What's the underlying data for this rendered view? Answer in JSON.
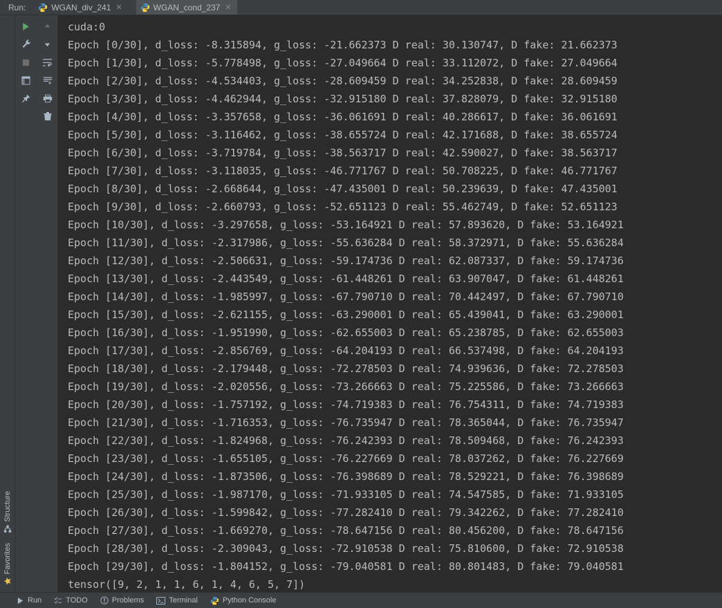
{
  "topbar": {
    "label": "Run:",
    "tabs": [
      {
        "name": "WGAN_div_241",
        "active": false
      },
      {
        "name": "WGAN_cond_237",
        "active": true
      }
    ]
  },
  "tool_buttons": [
    "run",
    "up-arrow",
    "wrench",
    "down-arrow",
    "stop",
    "soft-wrap",
    "layout",
    "scroll-to-end",
    "pin",
    "print",
    "",
    "trash"
  ],
  "left_rail": [
    {
      "label": "Structure",
      "icon": "structure-icon"
    },
    {
      "label": "Favorites",
      "icon": "star-icon"
    }
  ],
  "console": {
    "header": "cuda:0",
    "total_epochs": 30,
    "epochs": [
      {
        "i": 0,
        "d_loss": "-8.315894",
        "g_loss": "-21.662373",
        "d_real": "30.130747",
        "d_fake": "21.662373"
      },
      {
        "i": 1,
        "d_loss": "-5.778498",
        "g_loss": "-27.049664",
        "d_real": "33.112072",
        "d_fake": "27.049664"
      },
      {
        "i": 2,
        "d_loss": "-4.534403",
        "g_loss": "-28.609459",
        "d_real": "34.252838",
        "d_fake": "28.609459"
      },
      {
        "i": 3,
        "d_loss": "-4.462944",
        "g_loss": "-32.915180",
        "d_real": "37.828079",
        "d_fake": "32.915180"
      },
      {
        "i": 4,
        "d_loss": "-3.357658",
        "g_loss": "-36.061691",
        "d_real": "40.286617",
        "d_fake": "36.061691"
      },
      {
        "i": 5,
        "d_loss": "-3.116462",
        "g_loss": "-38.655724",
        "d_real": "42.171688",
        "d_fake": "38.655724"
      },
      {
        "i": 6,
        "d_loss": "-3.719784",
        "g_loss": "-38.563717",
        "d_real": "42.590027",
        "d_fake": "38.563717"
      },
      {
        "i": 7,
        "d_loss": "-3.118035",
        "g_loss": "-46.771767",
        "d_real": "50.708225",
        "d_fake": "46.771767"
      },
      {
        "i": 8,
        "d_loss": "-2.668644",
        "g_loss": "-47.435001",
        "d_real": "50.239639",
        "d_fake": "47.435001"
      },
      {
        "i": 9,
        "d_loss": "-2.660793",
        "g_loss": "-52.651123",
        "d_real": "55.462749",
        "d_fake": "52.651123"
      },
      {
        "i": 10,
        "d_loss": "-3.297658",
        "g_loss": "-53.164921",
        "d_real": "57.893620",
        "d_fake": "53.164921"
      },
      {
        "i": 11,
        "d_loss": "-2.317986",
        "g_loss": "-55.636284",
        "d_real": "58.372971",
        "d_fake": "55.636284"
      },
      {
        "i": 12,
        "d_loss": "-2.506631",
        "g_loss": "-59.174736",
        "d_real": "62.087337",
        "d_fake": "59.174736"
      },
      {
        "i": 13,
        "d_loss": "-2.443549",
        "g_loss": "-61.448261",
        "d_real": "63.907047",
        "d_fake": "61.448261"
      },
      {
        "i": 14,
        "d_loss": "-1.985997",
        "g_loss": "-67.790710",
        "d_real": "70.442497",
        "d_fake": "67.790710"
      },
      {
        "i": 15,
        "d_loss": "-2.621155",
        "g_loss": "-63.290001",
        "d_real": "65.439041",
        "d_fake": "63.290001"
      },
      {
        "i": 16,
        "d_loss": "-1.951990",
        "g_loss": "-62.655003",
        "d_real": "65.238785",
        "d_fake": "62.655003"
      },
      {
        "i": 17,
        "d_loss": "-2.856769",
        "g_loss": "-64.204193",
        "d_real": "66.537498",
        "d_fake": "64.204193"
      },
      {
        "i": 18,
        "d_loss": "-2.179448",
        "g_loss": "-72.278503",
        "d_real": "74.939636",
        "d_fake": "72.278503"
      },
      {
        "i": 19,
        "d_loss": "-2.020556",
        "g_loss": "-73.266663",
        "d_real": "75.225586",
        "d_fake": "73.266663"
      },
      {
        "i": 20,
        "d_loss": "-1.757192",
        "g_loss": "-74.719383",
        "d_real": "76.754311",
        "d_fake": "74.719383"
      },
      {
        "i": 21,
        "d_loss": "-1.716353",
        "g_loss": "-76.735947",
        "d_real": "78.365044",
        "d_fake": "76.735947"
      },
      {
        "i": 22,
        "d_loss": "-1.824968",
        "g_loss": "-76.242393",
        "d_real": "78.509468",
        "d_fake": "76.242393"
      },
      {
        "i": 23,
        "d_loss": "-1.655105",
        "g_loss": "-76.227669",
        "d_real": "78.037262",
        "d_fake": "76.227669"
      },
      {
        "i": 24,
        "d_loss": "-1.873506",
        "g_loss": "-76.398689",
        "d_real": "78.529221",
        "d_fake": "76.398689"
      },
      {
        "i": 25,
        "d_loss": "-1.987170",
        "g_loss": "-71.933105",
        "d_real": "74.547585",
        "d_fake": "71.933105"
      },
      {
        "i": 26,
        "d_loss": "-1.599842",
        "g_loss": "-77.282410",
        "d_real": "79.342262",
        "d_fake": "77.282410"
      },
      {
        "i": 27,
        "d_loss": "-1.669270",
        "g_loss": "-78.647156",
        "d_real": "80.456200",
        "d_fake": "78.647156"
      },
      {
        "i": 28,
        "d_loss": "-2.309043",
        "g_loss": "-72.910538",
        "d_real": "75.810600",
        "d_fake": "72.910538"
      },
      {
        "i": 29,
        "d_loss": "-1.804152",
        "g_loss": "-79.040581",
        "d_real": "80.801483",
        "d_fake": "79.040581"
      }
    ],
    "footer": "tensor([9, 2, 1, 1, 6, 1, 4, 6, 5, 7])"
  },
  "bottombar": {
    "items": [
      {
        "icon": "run-icon",
        "label": "Run"
      },
      {
        "icon": "todo-icon",
        "label": "TODO"
      },
      {
        "icon": "problems-icon",
        "label": "Problems"
      },
      {
        "icon": "terminal-icon",
        "label": "Terminal"
      },
      {
        "icon": "python-icon",
        "label": "Python Console"
      }
    ]
  }
}
